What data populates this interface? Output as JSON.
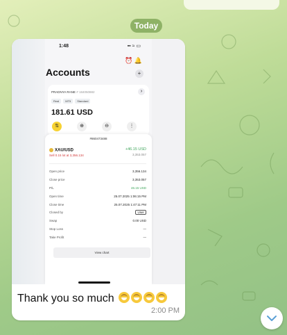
{
  "date_separator": "Today",
  "message": {
    "text": "Thank you so much",
    "time": "2:00 PM",
    "emoji_count": 4
  },
  "screenshot": {
    "status_time": "1:48",
    "status_icons": "▪▪ ≈ ▭",
    "top_icons": "⏰ 🔔",
    "title": "Accounts",
    "add_label": "+",
    "account": {
      "name": "PRADNYA RANE",
      "number": "# 184050882",
      "tags": [
        "Real",
        "MT5",
        "Standard"
      ],
      "balance": "181.61 USD",
      "arrow": "›"
    },
    "actions": [
      "⇅",
      "⊕",
      "⊖",
      "⋮"
    ],
    "order": {
      "id": "#860473488",
      "symbol": "XAU/USD",
      "side_text": "Sell 0.15 lot at 3,356.134",
      "pl_top": "+46.15 USD",
      "price_top": "3,353.057",
      "rows": [
        {
          "label": "Open price",
          "value": "3,356.134"
        },
        {
          "label": "Close price",
          "value": "3,353.057"
        },
        {
          "label": "P/L",
          "value": "46.15 USD"
        },
        {
          "label": "Open time",
          "value": "25.07.2025 1:06:15 PM"
        },
        {
          "label": "Close time",
          "value": "25.07.2025 1:47:11 PM"
        },
        {
          "label": "Closed by",
          "value": "User"
        },
        {
          "label": "Swap",
          "value": "0.00 USD"
        },
        {
          "label": "Stop Loss",
          "value": "—"
        },
        {
          "label": "Take Profit",
          "value": "—"
        }
      ],
      "button": "View chart"
    }
  },
  "colors": {
    "accent_green": "#3fa55b",
    "loss_red": "#d23b3b",
    "chat_bg": "#b5d590"
  },
  "icons": {
    "scroll_down": "chevron-down-icon"
  }
}
